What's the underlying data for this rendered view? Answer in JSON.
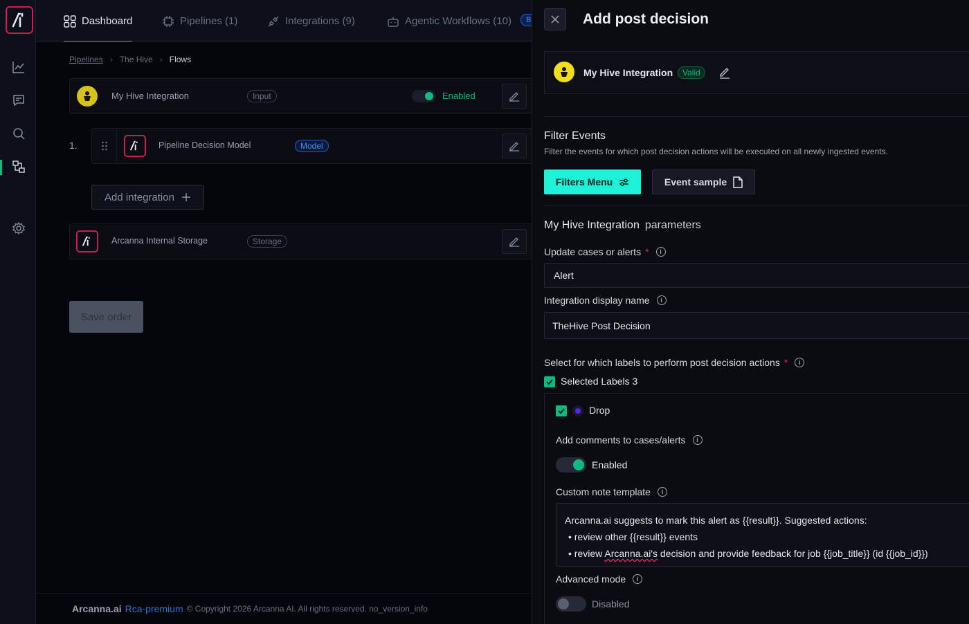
{
  "nav": {
    "tabs": [
      {
        "label": "Dashboard",
        "icon": "grid-icon",
        "active": true
      },
      {
        "label": "Pipelines (1)",
        "icon": "chip-icon",
        "active": false
      },
      {
        "label": "Integrations (9)",
        "icon": "plug-icon",
        "active": false
      },
      {
        "label": "Agentic Workflows (10)",
        "icon": "robot-icon",
        "active": false
      }
    ],
    "beta_badge": "B"
  },
  "rail": {
    "items": [
      "chart-icon",
      "chat-icon",
      "search-icon",
      "flows-icon",
      "gear-icon"
    ],
    "active": "flows-icon"
  },
  "breadcrumb": {
    "items": [
      "Pipelines",
      "The Hive",
      "Flows"
    ]
  },
  "flow": {
    "input": {
      "name": "My Hive Integration",
      "badge": "Input",
      "status": "Enabled"
    },
    "model_index": "1.",
    "model": {
      "name": "Pipeline Decision Model",
      "badge": "Model"
    },
    "add_integration": "Add integration",
    "storage": {
      "name": "Arcanna Internal Storage",
      "badge": "Storage"
    },
    "save_order": "Save order"
  },
  "footer": {
    "brand": "Arcanna.ai",
    "plan": "Rca-premium",
    "copyright": "© Copyright 2026 Arcanna AI. All rights reserved. no_version_info"
  },
  "panel": {
    "title": "Add post decision",
    "integration_name": "My Hive Integration",
    "integration_status": "Valid",
    "filter_title": "Filter Events",
    "filter_desc": "Filter the events for which post decision actions will be executed on all newly ingested events.",
    "filters_menu": "Filters Menu",
    "event_sample": "Event sample",
    "params_name": "My Hive Integration",
    "params_suffix": "parameters",
    "update_label": "Update cases or alerts",
    "update_value": "Alert",
    "display_name_label": "Integration display name",
    "display_name_value": "TheHive Post Decision",
    "labels_label": "Select for which labels to perform post decision actions",
    "selected_labels": "Selected Labels 3",
    "label_item": "Drop",
    "label_color": "#5b21f5",
    "comments_label": "Add comments to cases/alerts",
    "comments_state": "Enabled",
    "template_label": "Custom note template",
    "template_line1": "Arcanna.ai suggests to mark this alert as {{result}}. Suggested actions:",
    "template_line2": "• review other {{result}} events",
    "template_line3_pre": "• review ",
    "template_line3_word": "Arcanna.ai's",
    "template_line3_post": " decision and provide feedback for job {{job_title}} (id {{job_id}})",
    "advanced_label": "Advanced mode",
    "advanced_state": "Disabled"
  },
  "colors": {
    "accent": "#10b981",
    "brand": "#c8204a",
    "cta": "#1ef1d8"
  }
}
